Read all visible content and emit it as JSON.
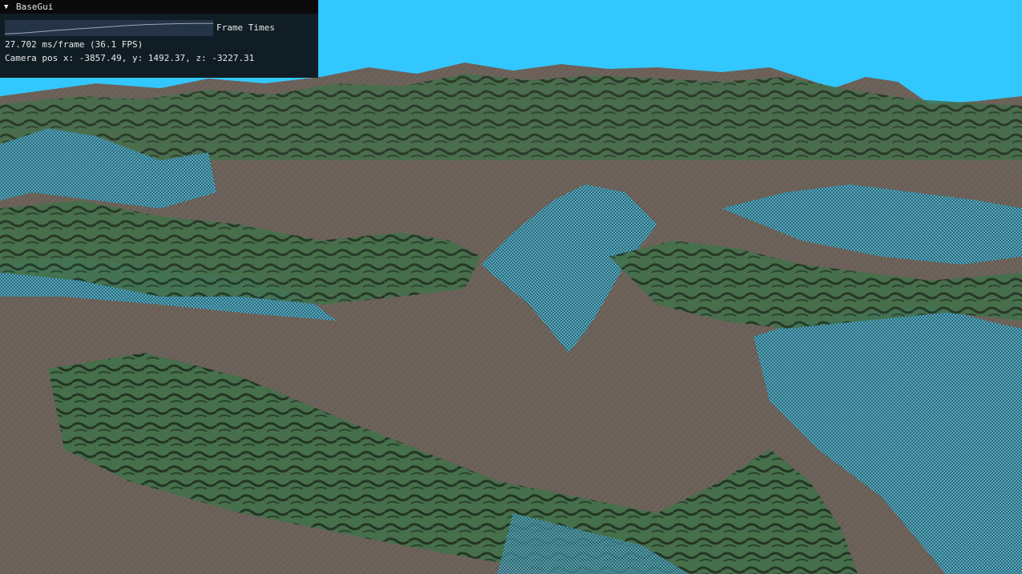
{
  "window": {
    "title": "BaseGui",
    "collapse_arrow": "▼"
  },
  "frame_times": {
    "label": "Frame Times",
    "values": [
      0.05,
      0.08,
      0.12,
      0.18,
      0.24,
      0.3,
      0.35,
      0.4,
      0.45,
      0.5,
      0.55,
      0.6,
      0.65,
      0.7,
      0.74,
      0.78,
      0.8,
      0.82,
      0.84,
      0.85,
      0.86,
      0.86,
      0.86
    ]
  },
  "stats": {
    "fps_text": "27.702 ms/frame (36.1 FPS)",
    "camera_text": "Camera pos x: -3857.49, y: 1492.37, z: -3227.31"
  },
  "scene": {
    "description_colors": {
      "sky": "#33c7ff",
      "rock": "#6e625a",
      "grass": "#3d6b45",
      "wireframe": "#4cc6e8"
    }
  }
}
